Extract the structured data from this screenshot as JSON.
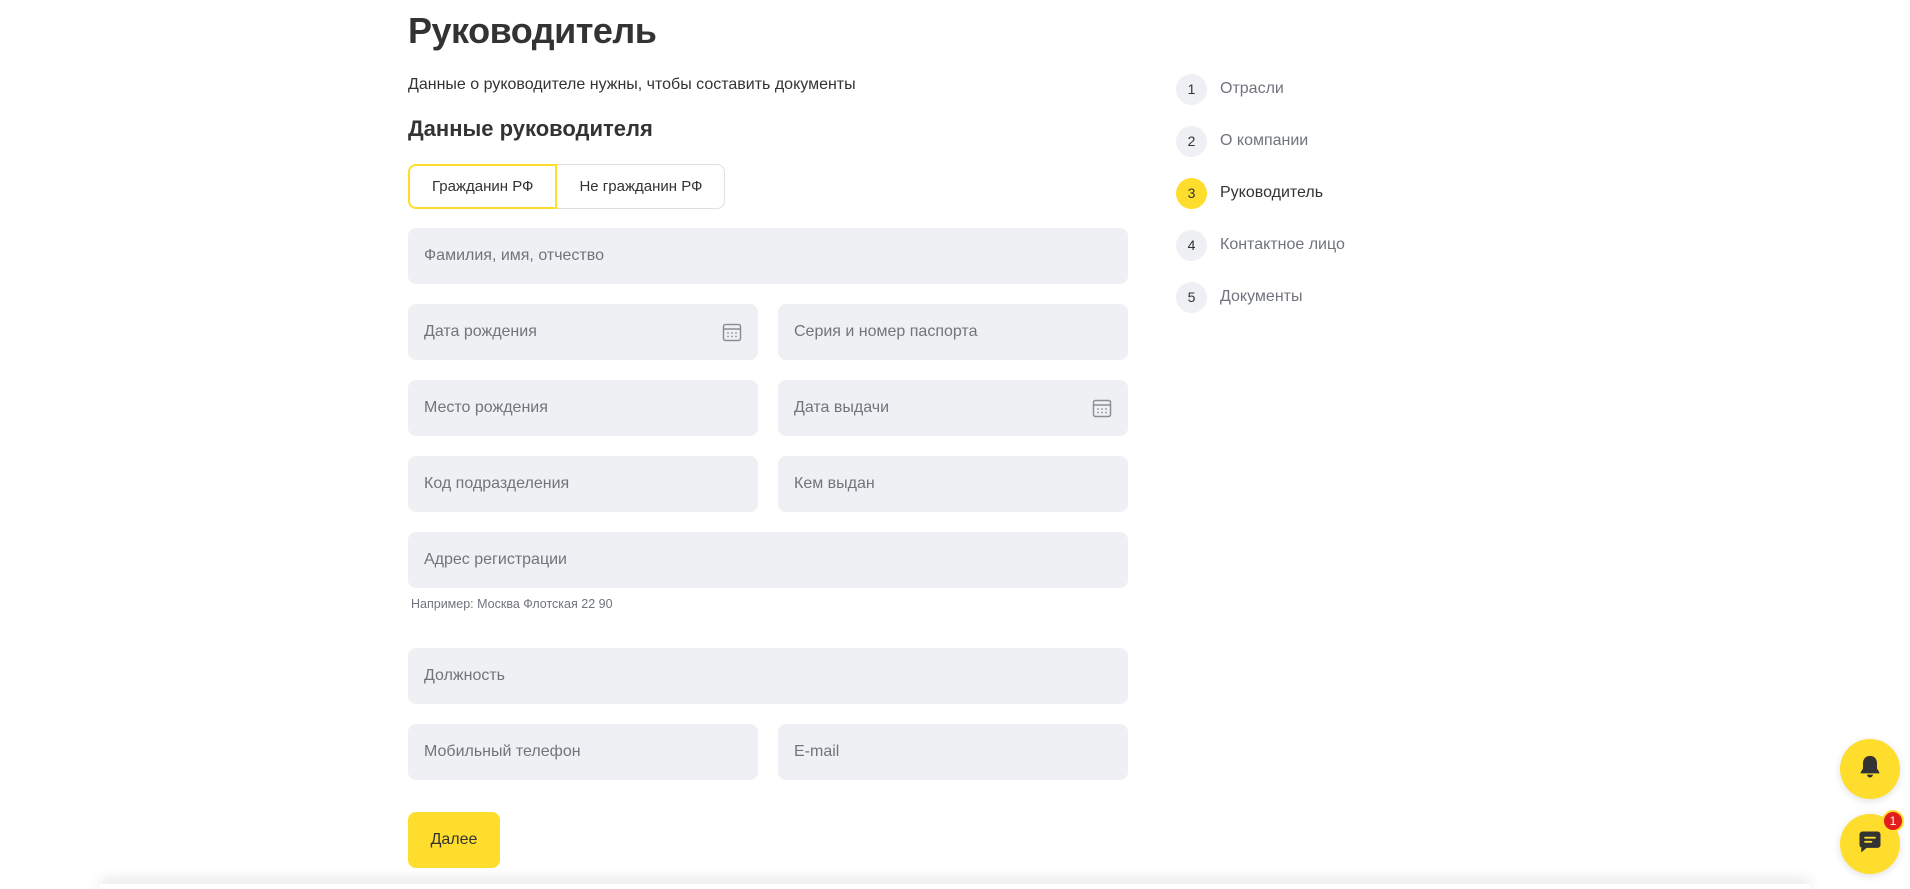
{
  "page": {
    "title": "Руководитель",
    "subtitle": "Данные о руководителе нужны, чтобы составить документы",
    "section_title": "Данные руководителя"
  },
  "citizenship": {
    "options": [
      "Гражданин РФ",
      "Не гражданин РФ"
    ],
    "selected": "Гражданин РФ"
  },
  "fields": {
    "full_name": "Фамилия, имя, отчество",
    "birth_date": "Дата рождения",
    "passport": "Серия и номер паспорта",
    "birth_place": "Место рождения",
    "issue_date": "Дата выдачи",
    "division_code": "Код подразделения",
    "issued_by": "Кем выдан",
    "address": "Адрес регистрации",
    "address_hint": "Например: Москва Флотская 22 90",
    "position": "Должность",
    "phone": "Мобильный телефон",
    "email": "E-mail"
  },
  "actions": {
    "next_label": "Далее"
  },
  "steps": [
    {
      "num": "1",
      "label": "Отрасли"
    },
    {
      "num": "2",
      "label": "О компании"
    },
    {
      "num": "3",
      "label": "Руководитель",
      "active": true
    },
    {
      "num": "4",
      "label": "Контактное лицо"
    },
    {
      "num": "5",
      "label": "Документы"
    }
  ],
  "chat": {
    "badge_count": "1"
  },
  "colors": {
    "accent": "#ffdd2d",
    "field_bg": "#eff0f3",
    "badge": "#e31c1c"
  }
}
